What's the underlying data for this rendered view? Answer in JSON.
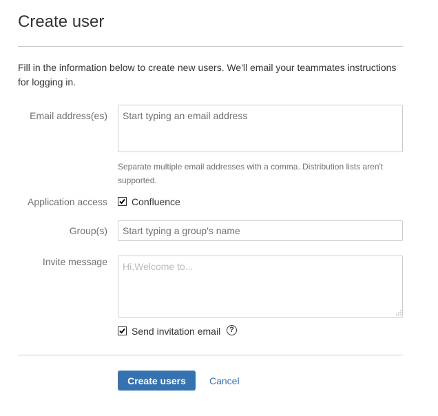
{
  "page": {
    "title": "Create user",
    "intro": "Fill in the information below to create new users. We'll email your teammates instructions for logging in."
  },
  "form": {
    "email": {
      "label": "Email address(es)",
      "value": "",
      "placeholder": "Start typing an email address",
      "helper": "Separate multiple email addresses with a comma. Distribution lists aren't supported."
    },
    "application_access": {
      "label": "Application access",
      "option_label": "Confluence",
      "checked": true
    },
    "groups": {
      "label": "Group(s)",
      "value": "",
      "placeholder": "Start typing a group's name"
    },
    "invite_message": {
      "label": "Invite message",
      "value": "",
      "placeholder": "Hi,Welcome to..."
    },
    "send_invitation": {
      "label": "Send invitation email",
      "checked": true,
      "help_icon": "question-circle-icon",
      "help_glyph": "?"
    }
  },
  "actions": {
    "submit_label": "Create users",
    "cancel_label": "Cancel"
  },
  "colors": {
    "primary": "#3572b0",
    "label_text": "#707070",
    "border": "#cccccc"
  }
}
